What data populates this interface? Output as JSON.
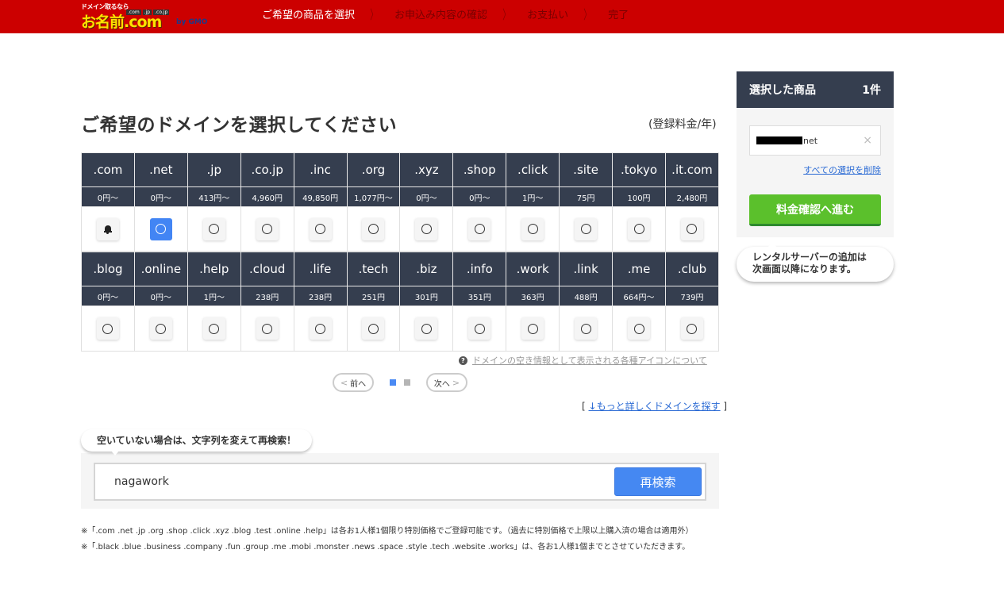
{
  "header": {
    "logo": {
      "tagline": "ドメイン取るなら",
      "name": "お名前.com",
      "tlds": [
        ".com",
        ".jp",
        ".co.jp"
      ],
      "by": "by GMO"
    },
    "steps": [
      {
        "label": "ご希望の商品を選択",
        "active": true
      },
      {
        "label": "お申込み内容の確認",
        "active": false
      },
      {
        "label": "お支払い",
        "active": false
      },
      {
        "label": "完了",
        "active": false
      }
    ],
    "step_separator": "〉"
  },
  "main": {
    "title": "ご希望のドメインを選択してください",
    "price_note": "(登録料金/年)",
    "domain_rows": [
      [
        {
          "tld": ".com",
          "price": "0円～",
          "status": "bell"
        },
        {
          "tld": ".net",
          "price": "0円～",
          "status": "selected"
        },
        {
          "tld": ".jp",
          "price": "413円～",
          "status": "available"
        },
        {
          "tld": ".co.jp",
          "price": "4,960円",
          "status": "available"
        },
        {
          "tld": ".inc",
          "price": "49,850円",
          "status": "available"
        },
        {
          "tld": ".org",
          "price": "1,077円～",
          "status": "available"
        },
        {
          "tld": ".xyz",
          "price": "0円～",
          "status": "available"
        },
        {
          "tld": ".shop",
          "price": "0円～",
          "status": "available"
        },
        {
          "tld": ".click",
          "price": "1円～",
          "status": "available"
        },
        {
          "tld": ".site",
          "price": "75円",
          "status": "available"
        },
        {
          "tld": ".tokyo",
          "price": "100円",
          "status": "available"
        },
        {
          "tld": ".it.com",
          "price": "2,480円",
          "status": "available"
        }
      ],
      [
        {
          "tld": ".blog",
          "price": "0円～",
          "status": "available"
        },
        {
          "tld": ".online",
          "price": "0円～",
          "status": "available"
        },
        {
          "tld": ".help",
          "price": "1円～",
          "status": "available"
        },
        {
          "tld": ".cloud",
          "price": "238円",
          "status": "available"
        },
        {
          "tld": ".life",
          "price": "238円",
          "status": "available"
        },
        {
          "tld": ".tech",
          "price": "251円",
          "status": "available"
        },
        {
          "tld": ".biz",
          "price": "301円",
          "status": "available"
        },
        {
          "tld": ".info",
          "price": "351円",
          "status": "available"
        },
        {
          "tld": ".work",
          "price": "363円",
          "status": "available"
        },
        {
          "tld": ".link",
          "price": "488円",
          "status": "available"
        },
        {
          "tld": ".me",
          "price": "664円～",
          "status": "available"
        },
        {
          "tld": ".club",
          "price": "739円",
          "status": "available"
        }
      ]
    ],
    "icon_info": {
      "icon": "question-circle-icon",
      "link": "ドメインの空き情報として表示される各種アイコンについて"
    },
    "pager": {
      "prev": "前へ",
      "next": "次へ",
      "pages": 2,
      "current": 1
    },
    "more_link": {
      "open": "[",
      "label": "↓もっと詳しくドメインを探す",
      "close": "]"
    },
    "research": {
      "hint": "空いていない場合は、文字列を変えて再検索！",
      "input_value": "nagawork",
      "button": "再検索"
    },
    "notes": [
      "※「.com .net .jp .org .shop .click .xyz .blog .test .online .help」は各お1人様1個限り特別価格でご登録可能です。（過去に特別価格で上限以上購入済の場合は適用外）",
      "※「.black .blue .business .company .fun .group .me .mobi .monster .news .space .style .tech .website .works」は、各お1人様1個までとさせていただきます。"
    ]
  },
  "cart": {
    "title": "選択した商品",
    "count": "1件",
    "item_suffix": "net",
    "remove_icon": "×",
    "clear_all": "すべての選択を削除",
    "proceed": "料金確認へ進む",
    "note_line1": "レンタルサーバーの追加は",
    "note_line2": "次画面以降になります。"
  },
  "colors": {
    "header_red": "#cc0000",
    "navy": "#353e4f",
    "selected_blue": "#4285f4",
    "proceed_green": "#5bc02c",
    "link_blue": "#2a6ad4"
  }
}
